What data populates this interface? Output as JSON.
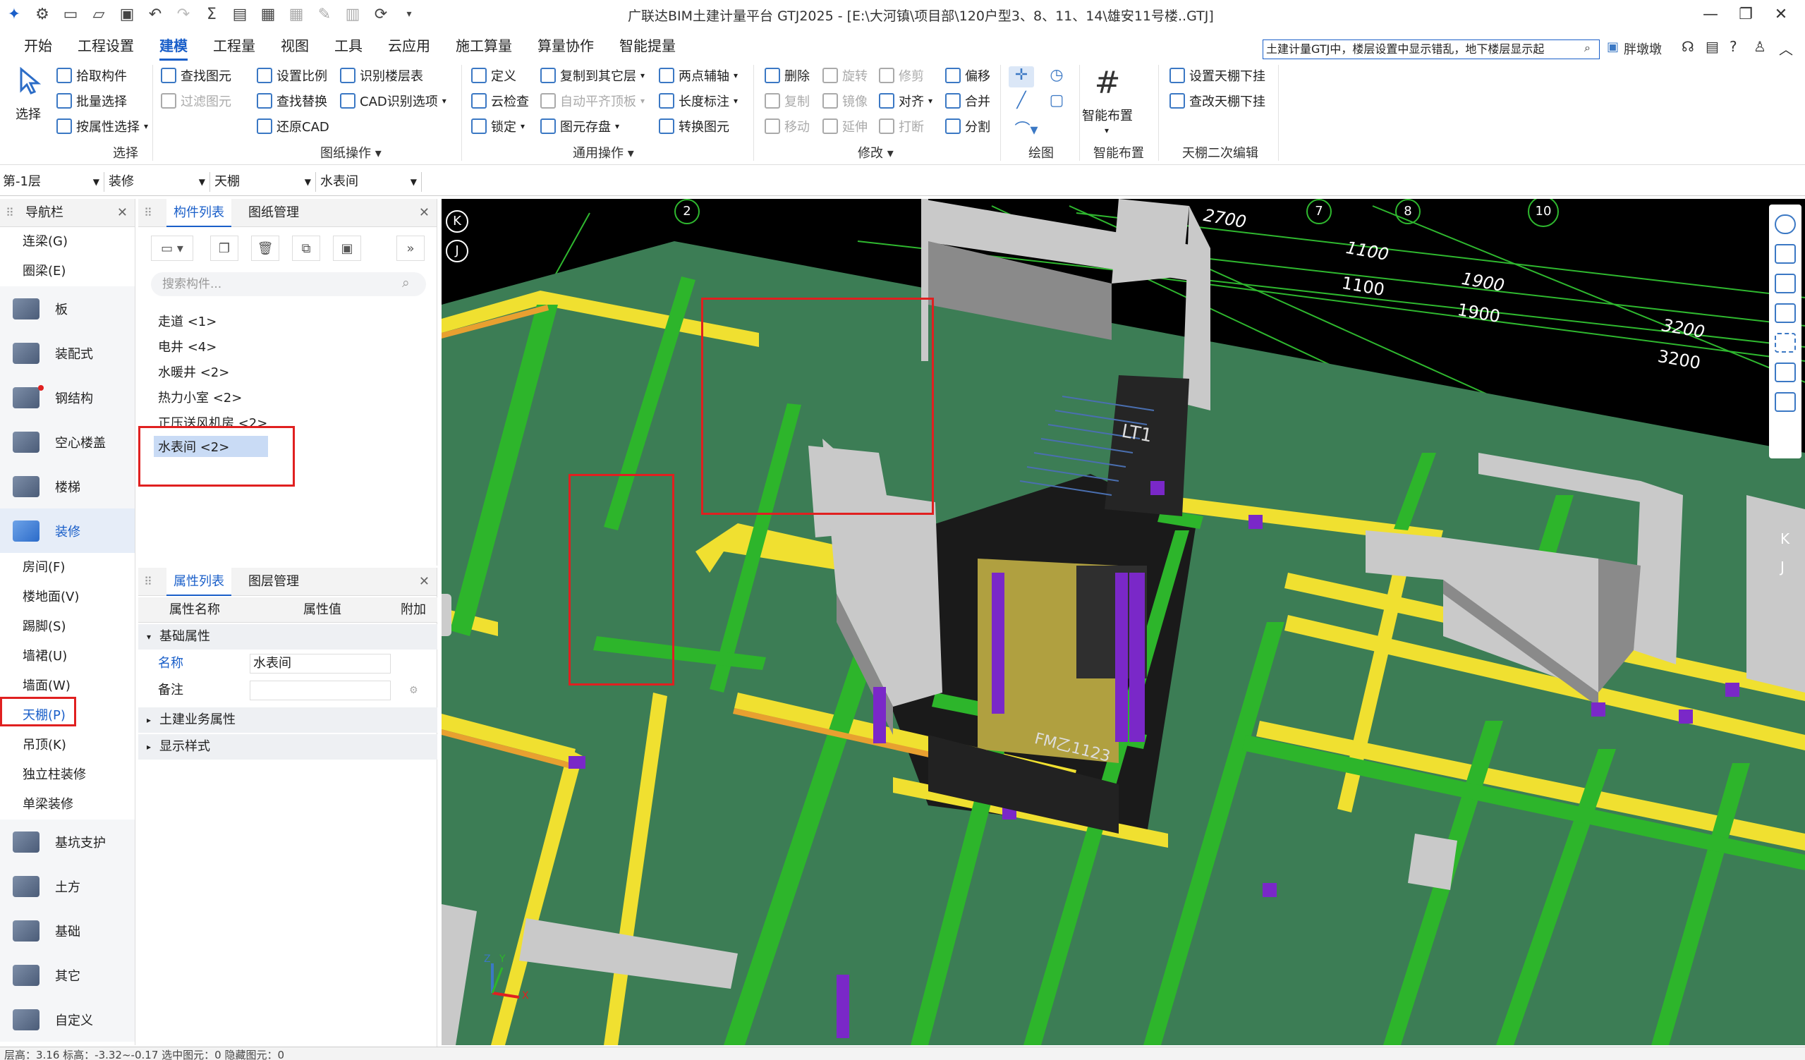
{
  "app": {
    "title": "广联达BIM土建计量平台 GTJ2025 - [E:\\大河镇\\项目部\\120户型3、8、11、14\\雄安11号楼..GTJ]"
  },
  "menubar": {
    "items": [
      "开始",
      "工程设置",
      "建模",
      "工程量",
      "视图",
      "工具",
      "云应用",
      "施工算量",
      "算量协作",
      "智能提量"
    ],
    "active": "建模",
    "search_text": "土建计量GTJ中，楼层设置中显示错乱，地下楼层显示起",
    "user": "胖墩墩"
  },
  "ribbon": {
    "select": {
      "big": "选择",
      "items": [
        "拾取构件",
        "批量选择",
        "按属性选择"
      ],
      "group": "选择"
    },
    "drawing": {
      "items": [
        "查找图元",
        "过滤图元",
        "设置比例",
        "查找替换",
        "还原CAD",
        "识别楼层表",
        "CAD识别选项"
      ],
      "group": "图纸操作"
    },
    "common": {
      "items": [
        "定义",
        "云检查",
        "锁定",
        "复制到其它层",
        "自动平齐顶板",
        "图元存盘",
        "两点辅轴",
        "长度标注",
        "转换图元"
      ],
      "group": "通用操作"
    },
    "modify": {
      "items": [
        "删除",
        "旋转",
        "修剪",
        "偏移",
        "复制",
        "镜像",
        "对齐",
        "合并",
        "移动",
        "延伸",
        "打断",
        "分割"
      ],
      "group": "修改"
    },
    "draw": {
      "group": "绘图"
    },
    "smart": {
      "big": "智能布置",
      "group": "智能布置"
    },
    "ceiling": {
      "items": [
        "设置天棚下挂",
        "查改天棚下挂"
      ],
      "group": "天棚二次编辑"
    }
  },
  "selectors": {
    "floor": "第-1层",
    "category": "装修",
    "type": "天棚",
    "component": "水表间"
  },
  "nav": {
    "title": "导航栏",
    "top_items": [
      "连梁(G)",
      "圈梁(E)"
    ],
    "main_items": [
      "板",
      "装配式",
      "钢结构",
      "空心楼盖",
      "楼梯",
      "装修"
    ],
    "sub_items": [
      "房间(F)",
      "楼地面(V)",
      "踢脚(S)",
      "墙裙(U)",
      "墙面(W)",
      "天棚(P)",
      "吊顶(K)",
      "独立柱装修",
      "单梁装修"
    ],
    "bottom_items": [
      "基坑支护",
      "土方",
      "基础",
      "其它",
      "自定义"
    ],
    "highlighted_sub": "天棚(P)"
  },
  "component_panel": {
    "tabs": [
      "构件列表",
      "图纸管理"
    ],
    "search_placeholder": "搜索构件...",
    "items": [
      "走道 <1>",
      "电井 <4>",
      "水暖井 <2>",
      "热力小室 <2>",
      "正压送风机房 <2>",
      "水表间 <2>"
    ],
    "selected": "水表间 <2>"
  },
  "property_panel": {
    "tabs": [
      "属性列表",
      "图层管理"
    ],
    "headers": [
      "属性名称",
      "属性值",
      "附加"
    ],
    "group_basic": "基础属性",
    "rows": [
      {
        "name": "名称",
        "value": "水表间"
      },
      {
        "name": "备注",
        "value": ""
      }
    ],
    "group_civil": "土建业务属性",
    "group_display": "显示样式"
  },
  "viewport": {
    "axis_labels": [
      "K",
      "J",
      "2",
      "7",
      "8",
      "10",
      "K",
      "J"
    ],
    "dims": [
      "2700",
      "1100",
      "1100",
      "1900",
      "1900",
      "3200",
      "3200"
    ],
    "stair_label": "LT1",
    "door_label": "FM乙1123",
    "coord": {
      "z": "Z",
      "y": "Y",
      "x": "X"
    }
  },
  "statusbar": {
    "text": "层高：3.16    标高：-3.32~-0.17    选中图元：0    隐藏图元：0"
  },
  "colors": {
    "accent": "#1a5fc9",
    "slab": "#3c7d55",
    "beam_green": "#2db52b",
    "beam_yellow": "#f0e030",
    "wall_grey": "#c9c9c9",
    "highlight_red": "#e02020"
  }
}
